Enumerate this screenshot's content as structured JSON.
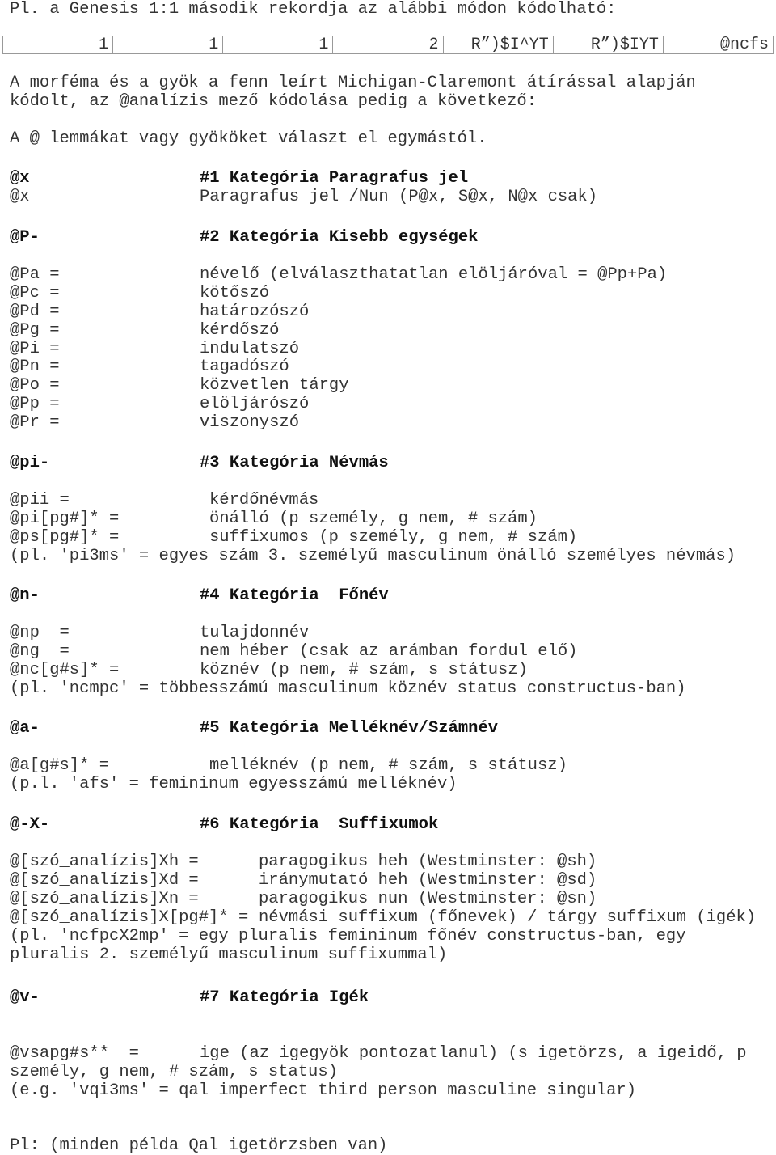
{
  "intro": "Pl. a Genesis 1:1 második rekordja az alábbi módon kódolható:",
  "record_table": [
    "1",
    "1",
    "1",
    "2",
    "R”)$I^YT",
    "R”)$IYT",
    "@ncfs"
  ],
  "description_lines": [
    "A morféma és a gyök a fenn leírt Michigan-Claremont átírással alapján",
    "kódolt, az @analízis mező kódolása pedig a következő:"
  ],
  "separator_note": "A @ lemmákat vagy gyököket választ el egymástól.",
  "categories": [
    {
      "code": "@x",
      "title": "#1 Kategória Paragrafus jel",
      "entries": [
        {
          "code": "@x",
          "meaning": "Paragrafus jel /Nun (P@x, S@x, N@x csak)"
        }
      ]
    },
    {
      "code": "@P-",
      "title": "#2 Kategória Kisebb egységek",
      "entries": [
        {
          "code": "@Pa =",
          "meaning": "névelő (elválaszthatatlan elöljáróval = @Pp+Pa)"
        },
        {
          "code": "@Pc =",
          "meaning": "kötőszó"
        },
        {
          "code": "@Pd =",
          "meaning": "határozószó"
        },
        {
          "code": "@Pg =",
          "meaning": "kérdőszó"
        },
        {
          "code": "@Pi =",
          "meaning": "indulatszó"
        },
        {
          "code": "@Pn =",
          "meaning": "tagadószó"
        },
        {
          "code": "@Po =",
          "meaning": "közvetlen tárgy"
        },
        {
          "code": "@Pp =",
          "meaning": "elöljárószó"
        },
        {
          "code": "@Pr =",
          "meaning": "viszonyszó"
        }
      ]
    },
    {
      "code": "@pi-",
      "title": "#3 Kategória Névmás",
      "entries": [
        {
          "code": "@pii =",
          "meaning": "kérdőnévmás"
        },
        {
          "code": "@pi[pg#]* =",
          "meaning": "önálló (p személy, g nem, # szám)"
        },
        {
          "code": "@ps[pg#]* =",
          "meaning": "suffixumos (p személy, g nem, # szám)"
        }
      ],
      "example": "(pl. 'pi3ms' = egyes szám 3. személyű masculinum önálló személyes névmás)"
    },
    {
      "code": "@n-",
      "title": "#4 Kategória  Főnév",
      "entries": [
        {
          "code": "@np  =",
          "meaning": "tulajdonnév"
        },
        {
          "code": "@ng  =",
          "meaning": "nem héber (csak az arámban fordul elő)"
        },
        {
          "code": "@nc[g#s]* =",
          "meaning": "köznév (p nem, # szám, s státusz)"
        }
      ],
      "example": "(pl. 'ncmpc' = többesszámú masculinum köznév status constructus-ban)"
    },
    {
      "code": "@a-",
      "title": "#5 Kategória Melléknév/Számnév",
      "entries": [
        {
          "code": "@a[g#s]* =",
          "meaning": "melléknév (p nem, # szám, s státusz)"
        }
      ],
      "example": "(p.l. 'afs' = femininum egyesszámú melléknév)"
    },
    {
      "code": "@-X-",
      "title": "#6 Kategória  Suffixumok",
      "entries": [
        {
          "code": "@[szó_analízis]Xh =",
          "meaning": "paragogikus heh (Westminster: @sh)"
        },
        {
          "code": "@[szó_analízis]Xd =",
          "meaning": "iránymutató heh (Westminster: @sd)"
        },
        {
          "code": "@[szó_analízis]Xn =",
          "meaning": "paragogikus nun (Westminster: @sn)"
        },
        {
          "code": "@[szó_analízis]X[pg#]* =",
          "meaning": "névmási suffixum (főnevek) / tárgy suffixum (igék)"
        }
      ],
      "example_lines": [
        "(pl. 'ncfpcX2mp' = egy pluralis femininum főnév constructus-ban, egy",
        "pluralis 2. személyű masculinum suffixummal)"
      ]
    },
    {
      "code": "@v-",
      "title": "#7 Kategória Igék",
      "entries": [
        {
          "code": "@vsapg#s**  =",
          "meaning": "ige (az igegyök pontozatlanul) (s igetörzs, a igeidő, p"
        }
      ],
      "continuation": "személy, g nem, # szám, s status)",
      "example": "(e.g. 'vqi3ms' = qal imperfect third person masculine singular)"
    }
  ],
  "footer_note": "Pl: (minden példa Qal igetörzsben van)"
}
